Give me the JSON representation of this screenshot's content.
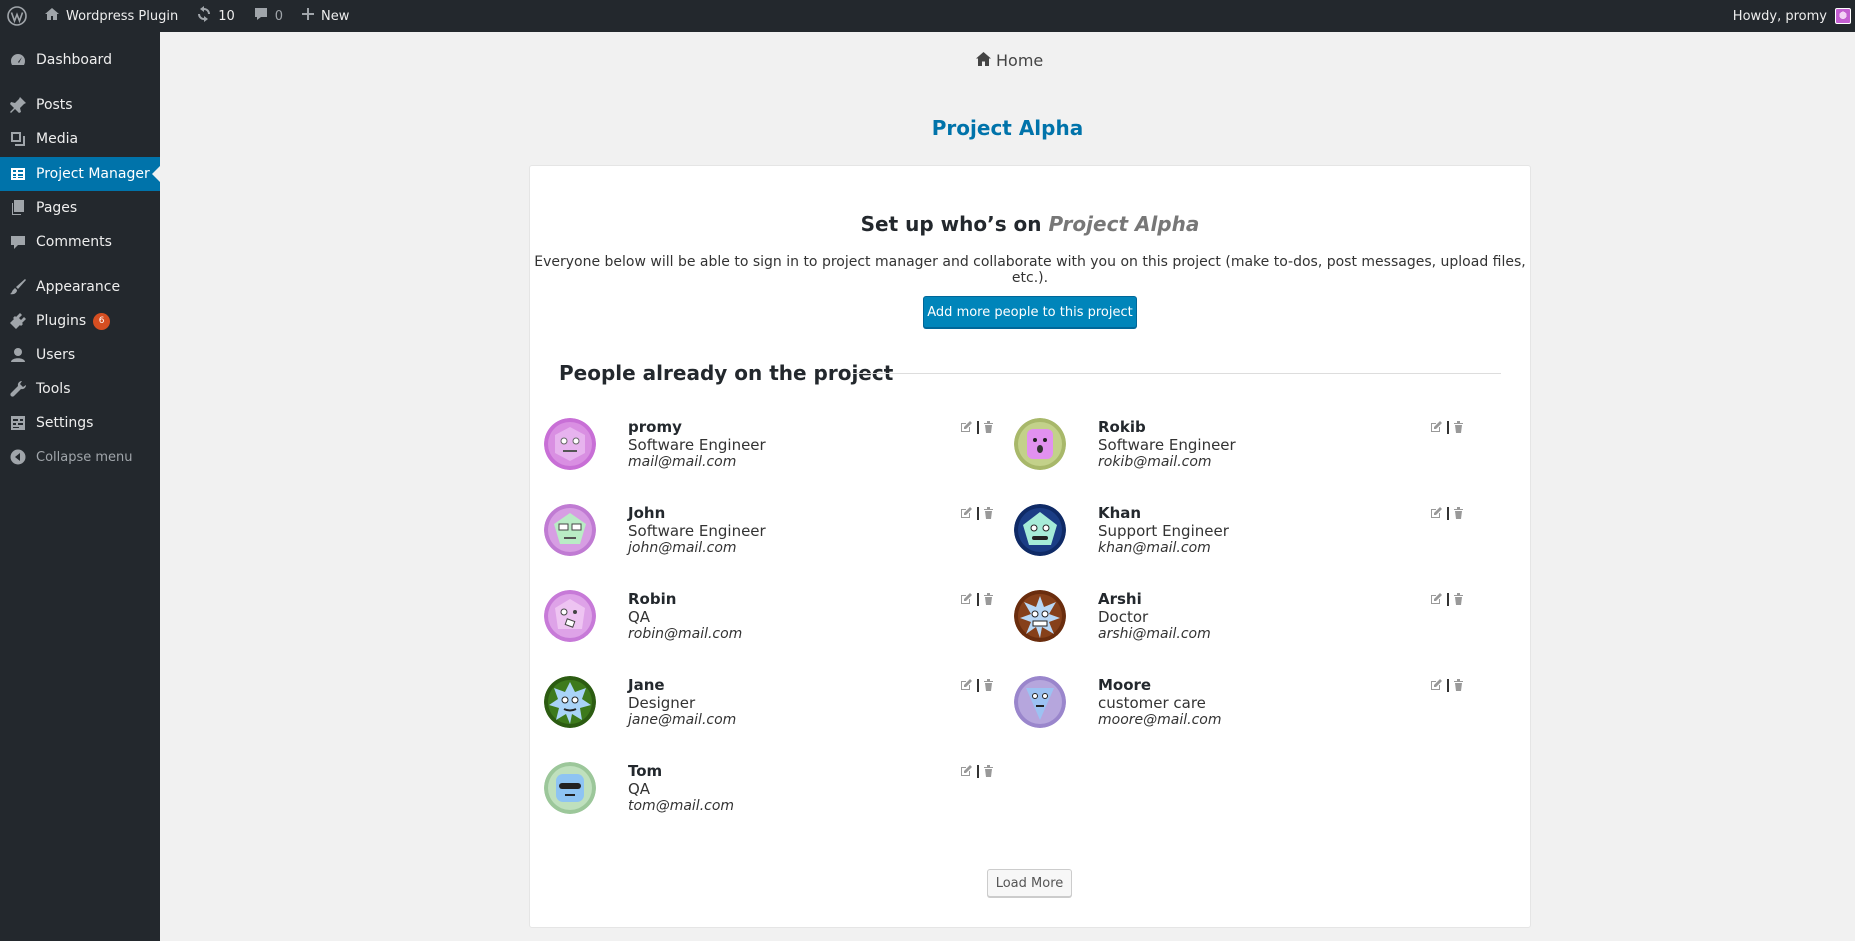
{
  "adminbar": {
    "site_name": "Wordpress Plugin",
    "updates_count": "10",
    "comments_count": "0",
    "new_label": "New",
    "howdy": "Howdy, promy"
  },
  "sidebar": {
    "items": [
      {
        "label": "Dashboard",
        "icon": "dashboard-icon"
      },
      {
        "label": "Posts",
        "icon": "pin-icon"
      },
      {
        "label": "Media",
        "icon": "media-icon"
      },
      {
        "label": "Project Manager",
        "icon": "table-icon",
        "active": true
      },
      {
        "label": "Pages",
        "icon": "pages-icon"
      },
      {
        "label": "Comments",
        "icon": "comment-icon"
      },
      {
        "label": "Appearance",
        "icon": "brush-icon"
      },
      {
        "label": "Plugins",
        "icon": "plugin-icon",
        "badge": "6"
      },
      {
        "label": "Users",
        "icon": "user-icon"
      },
      {
        "label": "Tools",
        "icon": "wrench-icon"
      },
      {
        "label": "Settings",
        "icon": "settings-icon"
      },
      {
        "label": "Collapse menu",
        "icon": "collapse-icon"
      }
    ]
  },
  "main": {
    "home_label": "Home",
    "project_title": "Project Alpha",
    "setup_heading_prefix": "Set up who’s on",
    "setup_heading_project": "Project Alpha",
    "setup_description": "Everyone below will be able to sign in to project manager and collaborate with you on this project (make to-dos, post messages, upload files, etc.).",
    "add_people_label": "Add more people to this project",
    "people_heading": "People already on the project",
    "load_more_label": "Load More"
  },
  "people": [
    {
      "name": "promy",
      "role": "Software Engineer",
      "email": "mail@mail.com"
    },
    {
      "name": "Rokib",
      "role": "Software Engineer",
      "email": "rokib@mail.com"
    },
    {
      "name": "John",
      "role": "Software Engineer",
      "email": "john@mail.com"
    },
    {
      "name": "Khan",
      "role": "Support Engineer",
      "email": "khan@mail.com"
    },
    {
      "name": "Robin",
      "role": "QA",
      "email": "robin@mail.com"
    },
    {
      "name": "Arshi",
      "role": "Doctor",
      "email": "arshi@mail.com"
    },
    {
      "name": "Jane",
      "role": "Designer",
      "email": "jane@mail.com"
    },
    {
      "name": "Moore",
      "role": "customer care",
      "email": "moore@mail.com"
    },
    {
      "name": "Tom",
      "role": "QA",
      "email": "tom@mail.com"
    }
  ],
  "colors": {
    "admin_bg": "#23282d",
    "accent": "#0073aa",
    "button_primary": "#0085ba",
    "badge": "#d54e21"
  }
}
